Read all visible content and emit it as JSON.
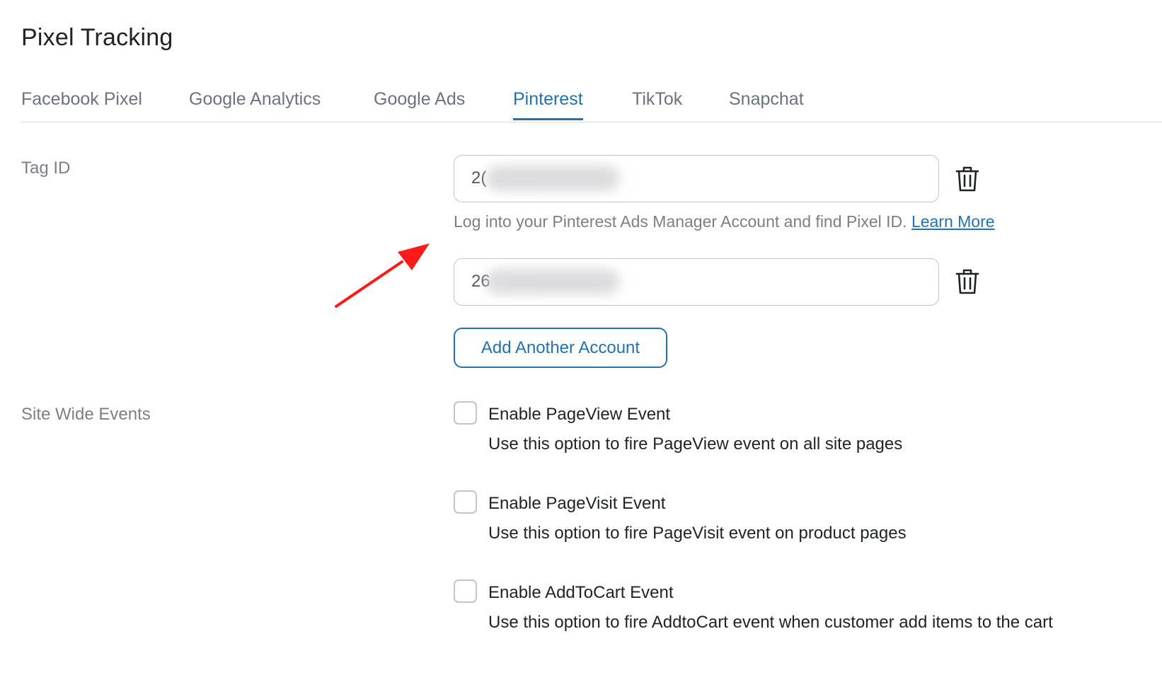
{
  "page": {
    "title": "Pixel Tracking"
  },
  "tabs": [
    {
      "label": "Facebook Pixel",
      "active": false
    },
    {
      "label": "Google Analytics",
      "active": false
    },
    {
      "label": "Google Ads",
      "active": false
    },
    {
      "label": "Pinterest",
      "active": true
    },
    {
      "label": "TikTok",
      "active": false
    },
    {
      "label": "Snapchat",
      "active": false
    }
  ],
  "tag_id": {
    "label": "Tag ID",
    "inputs": [
      {
        "visible_value": "2("
      },
      {
        "visible_value": "26"
      }
    ],
    "help_text": "Log into your Pinterest Ads Manager Account and find Pixel ID.",
    "learn_more": "Learn More",
    "add_button": "Add Another Account"
  },
  "site_wide_events": {
    "label": "Site Wide Events",
    "events": [
      {
        "title": "Enable PageView Event",
        "description": "Use this option to fire PageView event on all site pages",
        "checked": false
      },
      {
        "title": "Enable PageVisit Event",
        "description": "Use this option to fire PageVisit event on product pages",
        "checked": false
      },
      {
        "title": "Enable AddToCart Event",
        "description": "Use this option to fire AddtoCart event when customer add items to the cart",
        "checked": false
      }
    ]
  },
  "colors": {
    "accent": "#2271b1",
    "annotation_arrow": "#ff1a1a",
    "muted_text": "#7a7f87",
    "border": "#c3c4c7"
  },
  "icons": {
    "delete": "trash-icon",
    "annotation": "red-arrow-annotation"
  }
}
